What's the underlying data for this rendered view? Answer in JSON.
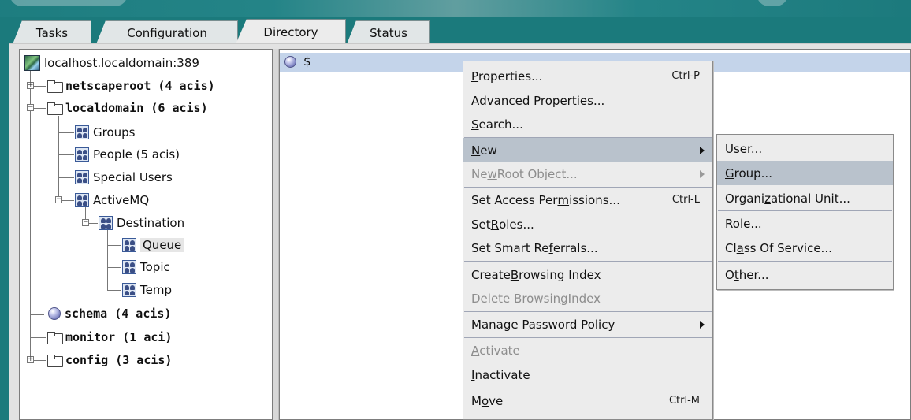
{
  "tabs": [
    {
      "label": "Tasks"
    },
    {
      "label": "Configuration"
    },
    {
      "label": "Directory",
      "active": true
    },
    {
      "label": "Status"
    }
  ],
  "tree": {
    "root": {
      "label": "localhost.localdomain:389"
    },
    "netscaperoot": {
      "label": "netscaperoot (4 acis)"
    },
    "localdomain": {
      "label": "localdomain (6 acis)"
    },
    "groups": {
      "label": "Groups"
    },
    "people": {
      "label": "People (5 acis)"
    },
    "special_users": {
      "label": "Special Users"
    },
    "activemq": {
      "label": "ActiveMQ"
    },
    "destination": {
      "label": "Destination"
    },
    "queue": {
      "label": "Queue"
    },
    "topic": {
      "label": "Topic"
    },
    "temp": {
      "label": "Temp"
    },
    "schema": {
      "label": "schema (4 acis)"
    },
    "monitor": {
      "label": "monitor (1 aci)"
    },
    "config": {
      "label": "config (3 acis)"
    }
  },
  "right_pane": {
    "header_text": "$"
  },
  "context_menu": {
    "properties": {
      "pre": "",
      "u": "P",
      "post": "roperties...",
      "shortcut": "Ctrl-P"
    },
    "advanced_properties": {
      "pre": "A",
      "u": "d",
      "post": "vanced Properties..."
    },
    "search": {
      "pre": "",
      "u": "S",
      "post": "earch..."
    },
    "new": {
      "pre": "",
      "u": "N",
      "post": "ew"
    },
    "new_root_object": {
      "pre": "Ne",
      "u": "w",
      "post": " Root Object..."
    },
    "set_access_permissions": {
      "pre": "Set Access Per",
      "u": "m",
      "post": "issions...",
      "shortcut": "Ctrl-L"
    },
    "set_roles": {
      "pre": "Set ",
      "u": "R",
      "post": "oles..."
    },
    "set_smart_referrals": {
      "pre": "Set Smart Re",
      "u": "f",
      "post": "errals..."
    },
    "create_browsing_index": {
      "pre": "Create ",
      "u": "B",
      "post": "rowsing Index"
    },
    "delete_browsing_index": {
      "pre": "Delete Browsin",
      "u": "g",
      "post": " Index"
    },
    "manage_password_policy": {
      "label": "Manage Password Policy"
    },
    "activate": {
      "pre": "",
      "u": "A",
      "post": "ctivate"
    },
    "inactivate": {
      "pre": "",
      "u": "I",
      "post": "nactivate"
    },
    "move": {
      "pre": "M",
      "u": "o",
      "post": "ve",
      "shortcut": "Ctrl-M"
    }
  },
  "submenu": {
    "user": {
      "pre": "",
      "u": "U",
      "post": "ser..."
    },
    "group": {
      "pre": "",
      "u": "G",
      "post": "roup..."
    },
    "organizational_unit": {
      "pre": "Organi",
      "u": "z",
      "post": "ational Unit..."
    },
    "role": {
      "pre": "Ro",
      "u": "l",
      "post": "e..."
    },
    "class_of_service": {
      "pre": "Cl",
      "u": "a",
      "post": "ss Of Service..."
    },
    "other": {
      "pre": "O",
      "u": "t",
      "post": "her..."
    }
  },
  "colors": {
    "background": "#1b7a7c",
    "menu_highlight": "#b9c2cc",
    "header_bar": "#c4d4ea"
  }
}
